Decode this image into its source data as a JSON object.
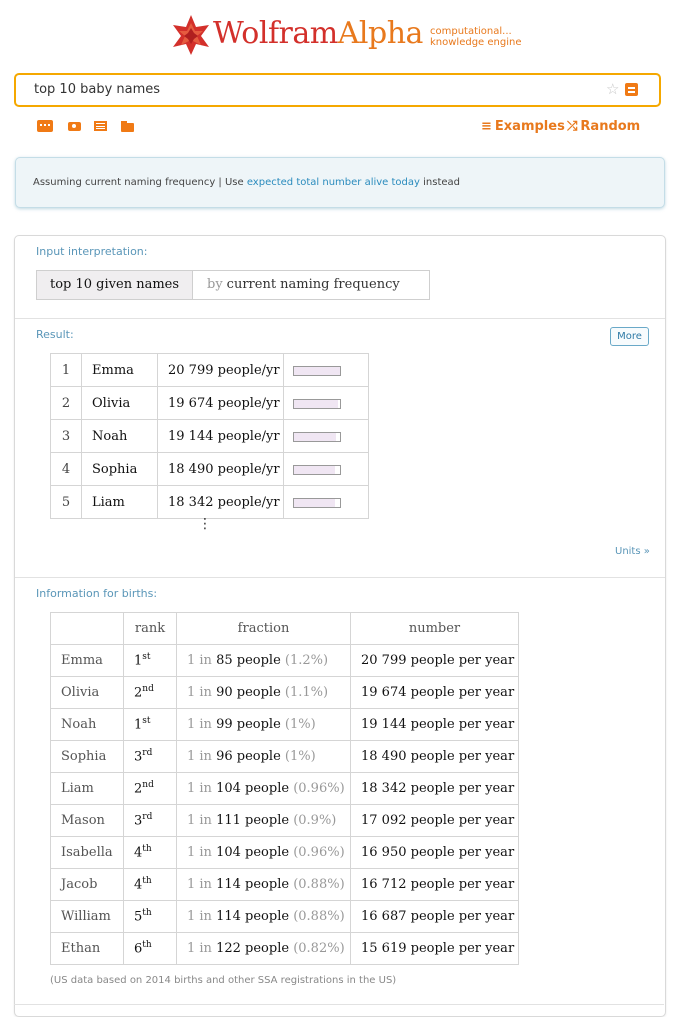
{
  "header": {
    "logo_wolfram": "Wolfram",
    "logo_alpha": "Alpha",
    "tagline_1": "computational...",
    "tagline_2": "knowledge engine"
  },
  "search": {
    "value": "top 10 baby names"
  },
  "toolbar": {
    "examples_label": "Examples",
    "random_label": "Random"
  },
  "assumption": {
    "prefix": "Assuming current naming frequency | Use ",
    "link": "expected total number alive today",
    "suffix": " instead"
  },
  "input_interpretation": {
    "label": "Input interpretation:",
    "query": "top 10 given names",
    "by": "by",
    "criterion": "current naming frequency"
  },
  "result": {
    "label": "Result:",
    "more_label": "More",
    "units_label": "Units »",
    "rows": [
      {
        "rank": "1",
        "name": "Emma",
        "value": "20 799",
        "unit": "people/yr",
        "count": 20799
      },
      {
        "rank": "2",
        "name": "Olivia",
        "value": "19 674",
        "unit": "people/yr",
        "count": 19674
      },
      {
        "rank": "3",
        "name": "Noah",
        "value": "19 144",
        "unit": "people/yr",
        "count": 19144
      },
      {
        "rank": "4",
        "name": "Sophia",
        "value": "18 490",
        "unit": "people/yr",
        "count": 18490
      },
      {
        "rank": "5",
        "name": "Liam",
        "value": "18 342",
        "unit": "people/yr",
        "count": 18342
      }
    ],
    "ellipsis": "⋮"
  },
  "births": {
    "label": "Information for births:",
    "columns": [
      "rank",
      "fraction",
      "number"
    ],
    "rows": [
      {
        "name": "Emma",
        "rank": "1",
        "suffix": "st",
        "one_in": "1 in",
        "fraction_value": "85",
        "fraction_unit": "people",
        "percent": "(1.2%)",
        "number": "20 799",
        "number_unit": "people per year"
      },
      {
        "name": "Olivia",
        "rank": "2",
        "suffix": "nd",
        "one_in": "1 in",
        "fraction_value": "90",
        "fraction_unit": "people",
        "percent": "(1.1%)",
        "number": "19 674",
        "number_unit": "people per year"
      },
      {
        "name": "Noah",
        "rank": "1",
        "suffix": "st",
        "one_in": "1 in",
        "fraction_value": "99",
        "fraction_unit": "people",
        "percent": "(1%)",
        "number": "19 144",
        "number_unit": "people per year"
      },
      {
        "name": "Sophia",
        "rank": "3",
        "suffix": "rd",
        "one_in": "1 in",
        "fraction_value": "96",
        "fraction_unit": "people",
        "percent": "(1%)",
        "number": "18 490",
        "number_unit": "people per year"
      },
      {
        "name": "Liam",
        "rank": "2",
        "suffix": "nd",
        "one_in": "1 in",
        "fraction_value": "104",
        "fraction_unit": "people",
        "percent": "(0.96%)",
        "number": "18 342",
        "number_unit": "people per year"
      },
      {
        "name": "Mason",
        "rank": "3",
        "suffix": "rd",
        "one_in": "1 in",
        "fraction_value": "111",
        "fraction_unit": "people",
        "percent": "(0.9%)",
        "number": "17 092",
        "number_unit": "people per year"
      },
      {
        "name": "Isabella",
        "rank": "4",
        "suffix": "th",
        "one_in": "1 in",
        "fraction_value": "104",
        "fraction_unit": "people",
        "percent": "(0.96%)",
        "number": "16 950",
        "number_unit": "people per year"
      },
      {
        "name": "Jacob",
        "rank": "4",
        "suffix": "th",
        "one_in": "1 in",
        "fraction_value": "114",
        "fraction_unit": "people",
        "percent": "(0.88%)",
        "number": "16 712",
        "number_unit": "people per year"
      },
      {
        "name": "William",
        "rank": "5",
        "suffix": "th",
        "one_in": "1 in",
        "fraction_value": "114",
        "fraction_unit": "people",
        "percent": "(0.88%)",
        "number": "16 687",
        "number_unit": "people per year"
      },
      {
        "name": "Ethan",
        "rank": "6",
        "suffix": "th",
        "one_in": "1 in",
        "fraction_value": "122",
        "fraction_unit": "people",
        "percent": "(0.82%)",
        "number": "15 619",
        "number_unit": "people per year"
      }
    ],
    "footnote": "(US data based on 2014 births and other SSA registrations in the US)"
  },
  "icons": [
    "wolfram-spikey-logo-icon",
    "star-icon",
    "orange-menu-icon",
    "keyboard-icon",
    "camera-icon",
    "table-icon",
    "folder-icon",
    "examples-list-icon",
    "random-shuffle-icon"
  ],
  "colors": {
    "brand_red": "#d3302b",
    "brand_orange": "#e8791d",
    "search_border": "#f5a800",
    "link_blue": "#2a8bbd",
    "label_blue": "#5a96b8"
  }
}
